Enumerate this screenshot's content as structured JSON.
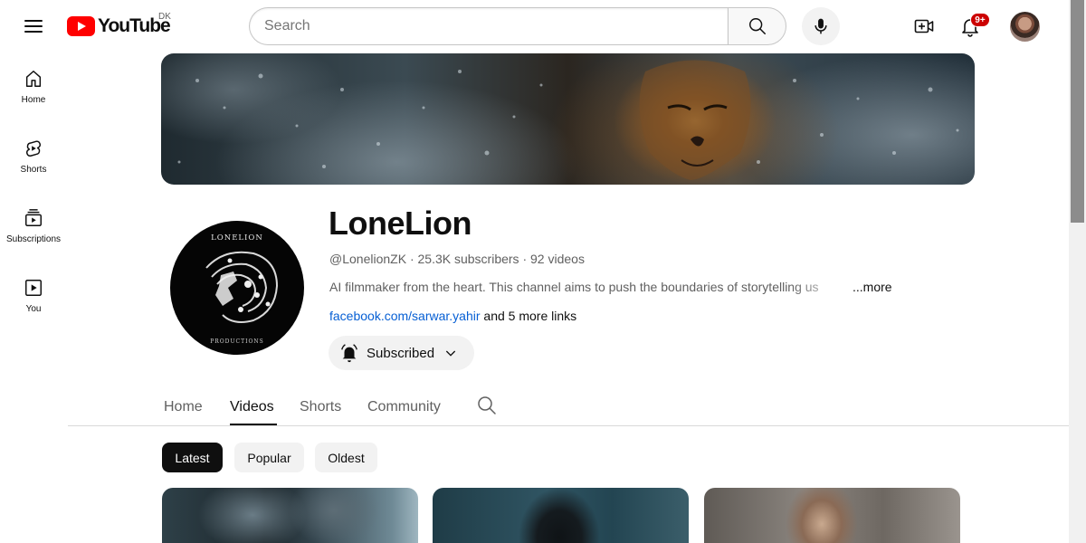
{
  "topbar": {
    "logo_text": "YouTube",
    "region": "DK",
    "search_placeholder": "Search",
    "notification_count": "9+"
  },
  "sidebar": {
    "items": [
      {
        "label": "Home",
        "icon": "home-icon"
      },
      {
        "label": "Shorts",
        "icon": "shorts-icon"
      },
      {
        "label": "Subscriptions",
        "icon": "subscriptions-icon"
      },
      {
        "label": "You",
        "icon": "you-icon"
      }
    ]
  },
  "channel": {
    "name": "LoneLion",
    "handle": "@LonelionZK",
    "subscribers": "25.3K subscribers",
    "videos": "92 videos",
    "description": "AI filmmaker from the heart. This channel aims to push the boundaries of storytelling us",
    "more_label": "...more",
    "link_text": "facebook.com/sarwar.yahir",
    "more_links": "and 5 more links",
    "subscribe_label": "Subscribed",
    "avatar_text_top": "LONELION",
    "avatar_text_bottom": "PRODUCTIONS"
  },
  "tabs": [
    {
      "label": "Home",
      "active": false
    },
    {
      "label": "Videos",
      "active": true
    },
    {
      "label": "Shorts",
      "active": false
    },
    {
      "label": "Community",
      "active": false
    }
  ],
  "filters": [
    {
      "label": "Latest",
      "active": true
    },
    {
      "label": "Popular",
      "active": false
    },
    {
      "label": "Oldest",
      "active": false
    }
  ],
  "colors": {
    "brand_red": "#ff0000",
    "link_blue": "#065fd4",
    "badge_red": "#cc0000"
  }
}
